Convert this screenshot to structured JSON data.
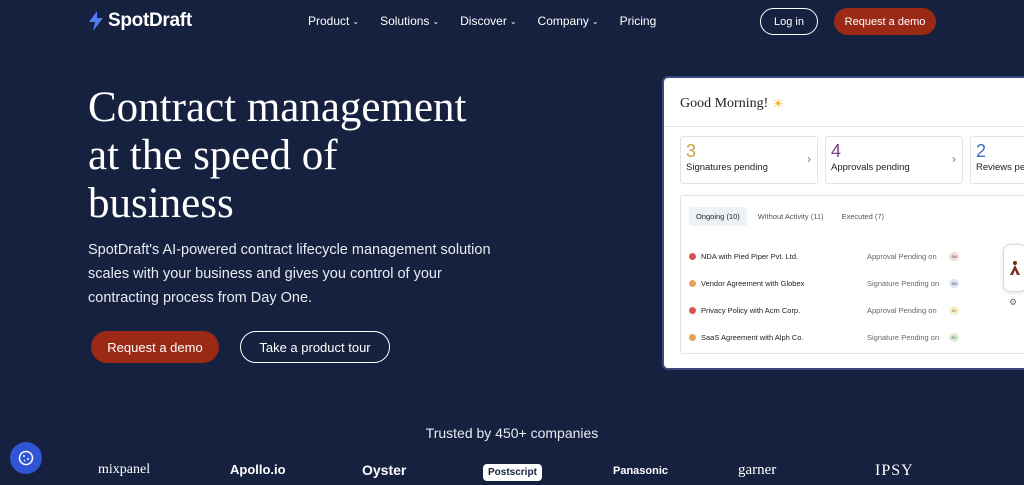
{
  "brand": {
    "name": "SpotDraft",
    "accent": "#9a2a16",
    "background": "#16213f"
  },
  "nav": {
    "items": [
      {
        "label": "Product",
        "has_dropdown": true
      },
      {
        "label": "Solutions",
        "has_dropdown": true
      },
      {
        "label": "Discover",
        "has_dropdown": true
      },
      {
        "label": "Company",
        "has_dropdown": true
      },
      {
        "label": "Pricing",
        "has_dropdown": false
      }
    ],
    "login": "Log in",
    "demo": "Request a demo"
  },
  "hero": {
    "title_lines": [
      "Contract management",
      "at the speed of",
      "business"
    ],
    "description": "SpotDraft's AI-powered contract lifecycle management solution scales with your business and gives you control of your contracting process from Day One.",
    "cta_primary": "Request a demo",
    "cta_secondary": "Take a product tour"
  },
  "dashboard": {
    "greeting": "Good Morning!",
    "greeting_icon": "sun-icon",
    "stats": [
      {
        "value": "3",
        "label": "Signatures pending",
        "color": "#c9a23a"
      },
      {
        "value": "4",
        "label": "Approvals pending",
        "color": "#7a3c8c"
      },
      {
        "value": "2",
        "label": "Reviews pen",
        "color": "#3b6fc2"
      }
    ],
    "tabs": [
      {
        "label": "Ongoing (10)",
        "active": true
      },
      {
        "label": "Without Activity (11)",
        "active": false
      },
      {
        "label": "Executed (7)",
        "active": false
      }
    ],
    "rows": [
      {
        "name": "NDA with Pied Piper Pvt. Ltd.",
        "status": "Approval Pending on",
        "badge": "JM",
        "icon_color": "#d9534f",
        "badge_color": "#f4d9d6"
      },
      {
        "name": "Vendor Agreement with Globex",
        "status": "Signature Pending on",
        "badge": "JM",
        "icon_color": "#e8a05c",
        "badge_color": "#dfe3f3"
      },
      {
        "name": "Privacy Policy with Acm Corp.",
        "status": "Approval Pending on",
        "badge": "KI",
        "icon_color": "#d9534f",
        "badge_color": "#f7efc8"
      },
      {
        "name": "SaaS Agreement with Alph Co.",
        "status": "Signature Pending on",
        "badge": "RJ",
        "icon_color": "#e8a05c",
        "badge_color": "#dcefd6"
      }
    ]
  },
  "trusted": {
    "heading": "Trusted by 450+ companies",
    "logos": [
      "mixpanel",
      "Apollo.io",
      "Oyster",
      "Postscript",
      "Panasonic",
      "garner",
      "IPSY"
    ]
  }
}
